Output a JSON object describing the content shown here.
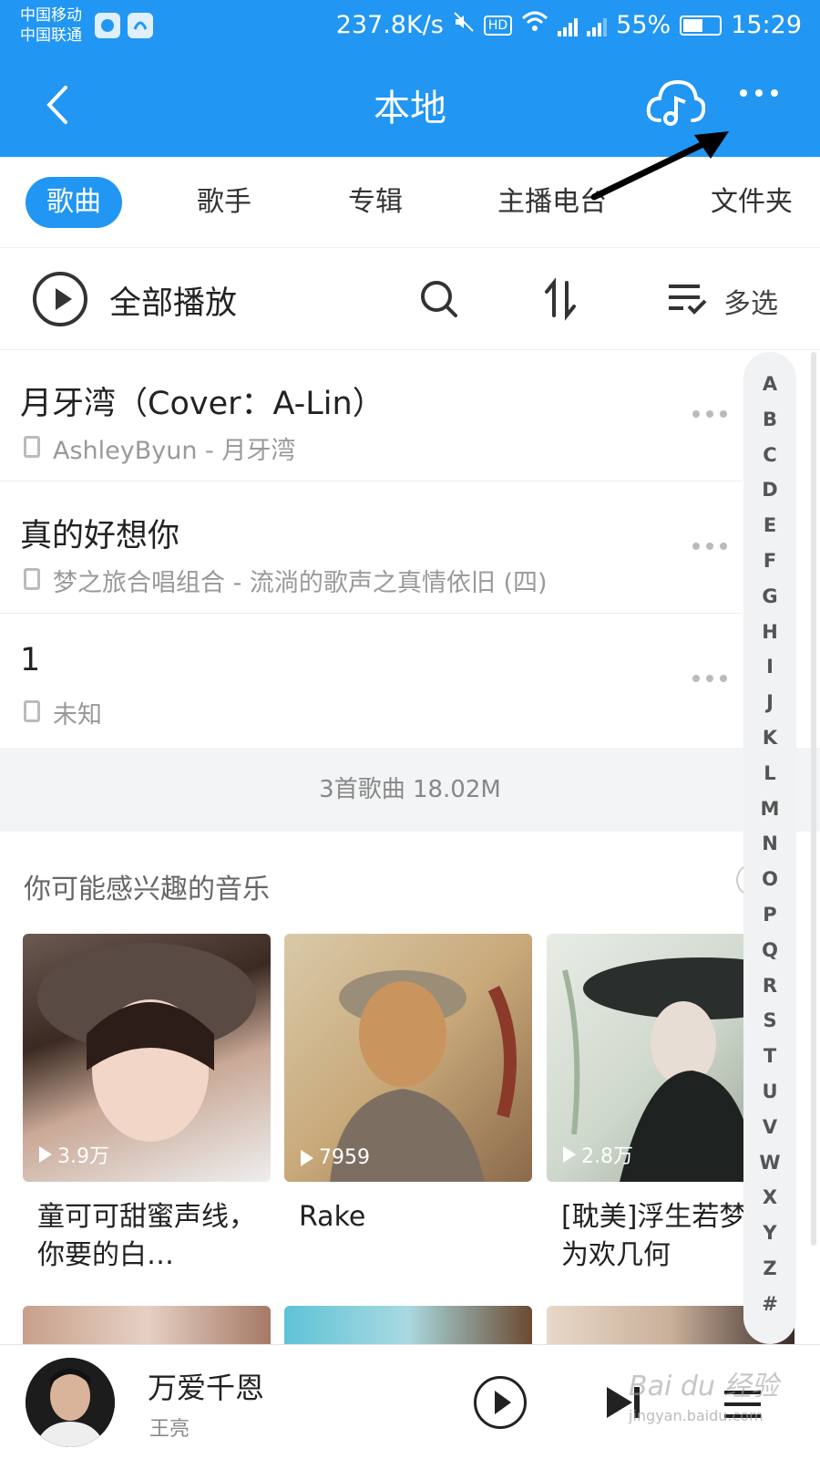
{
  "status_bar": {
    "carrier_1": "中国移动",
    "carrier_2": "中国联通",
    "net_speed": "237.8K/s",
    "hd_badge": "HD",
    "battery_text": "55%",
    "battery_level": 0.55,
    "time": "15:29",
    "signal_1_label": "4G",
    "signal_2_label": "3G"
  },
  "header": {
    "title": "本地",
    "back_icon": "chevron-left-icon",
    "cloud_icon": "cloud-music-icon",
    "more_icon": "more-dots-icon"
  },
  "tabs": [
    {
      "label": "歌曲",
      "active": true
    },
    {
      "label": "歌手",
      "active": false
    },
    {
      "label": "专辑",
      "active": false
    },
    {
      "label": "主播电台",
      "active": false
    },
    {
      "label": "文件夹",
      "active": false
    }
  ],
  "toolbar": {
    "play_all_label": "全部播放",
    "multi_select_label": "多选"
  },
  "songs": [
    {
      "title": "月牙湾（Cover：A-Lin）",
      "subtitle": "AshleyByun - 月牙湾"
    },
    {
      "title": "真的好想你",
      "subtitle": "梦之旅合唱组合 - 流淌的歌声之真情依旧 (四)"
    },
    {
      "title": "1",
      "subtitle": "未知"
    }
  ],
  "summary": "3首歌曲 18.02M",
  "recommend": {
    "title": "你可能感兴趣的音乐",
    "cards": [
      {
        "play_count": "3.9万",
        "title": "童可可甜蜜声线，你要的白…"
      },
      {
        "play_count": "7959",
        "title": "Rake"
      },
      {
        "play_count": "2.8万",
        "title": "[耽美]浮生若梦，为欢几何"
      }
    ]
  },
  "alphabet": [
    "A",
    "B",
    "C",
    "D",
    "E",
    "F",
    "G",
    "H",
    "I",
    "J",
    "K",
    "L",
    "M",
    "N",
    "O",
    "P",
    "Q",
    "R",
    "S",
    "T",
    "U",
    "V",
    "W",
    "X",
    "Y",
    "Z",
    "#"
  ],
  "player": {
    "song": "万爱千恩",
    "artist": "王亮",
    "watermark": "Bai du 经验",
    "watermark_sub": "jingyan.baidu.com"
  },
  "colors": {
    "accent": "#2196f3"
  }
}
